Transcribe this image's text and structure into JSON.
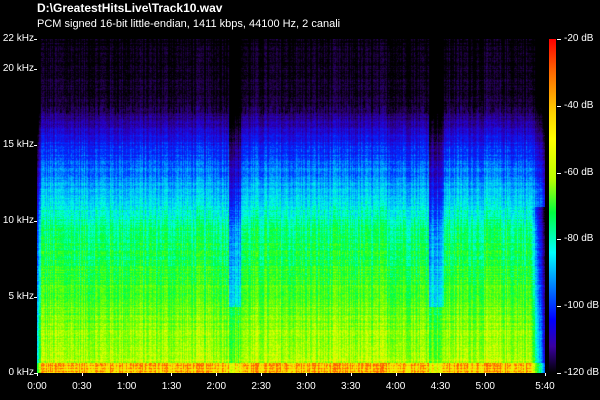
{
  "window": {
    "title": "D:\\GreatestHitsLive\\Track10.wav",
    "info": "PCM signed 16-bit little-endian, 1411 kbps, 44100 Hz, 2 canali"
  },
  "chart_data": {
    "type": "heatmap",
    "title": "D:\\GreatestHitsLive\\Track10.wav",
    "subtitle": "PCM signed 16-bit little-endian, 1411 kbps, 44100 Hz, 2 canali",
    "x_axis": {
      "ticks": [
        "0:00",
        "0:30",
        "1:00",
        "1:30",
        "2:00",
        "2:30",
        "3:00",
        "3:30",
        "4:00",
        "4:30",
        "5:00",
        "5:40"
      ],
      "seconds": [
        0,
        30,
        60,
        90,
        120,
        150,
        180,
        210,
        240,
        270,
        300,
        340
      ],
      "range": [
        0,
        340
      ]
    },
    "y_axis": {
      "ticks": [
        "0 kHz",
        "5 kHz",
        "10 kHz",
        "15 kHz",
        "20 kHz",
        "22 kHz"
      ],
      "khz": [
        0,
        5,
        10,
        15,
        20,
        22
      ],
      "range": [
        0,
        22
      ]
    },
    "colorbar": {
      "ticks": [
        "-20 dB",
        "-40 dB",
        "-60 dB",
        "-80 dB",
        "-100 dB",
        "-120 dB"
      ],
      "db": [
        -20,
        -40,
        -60,
        -80,
        -100,
        -120
      ],
      "range": [
        -120,
        -20
      ],
      "colors": [
        "#ff0000",
        "#ffff00",
        "#00ff40",
        "#00ffff",
        "#0000ff",
        "#000000"
      ]
    },
    "quiet_sections_seconds": [
      [
        128,
        136
      ],
      [
        262,
        272
      ]
    ]
  }
}
